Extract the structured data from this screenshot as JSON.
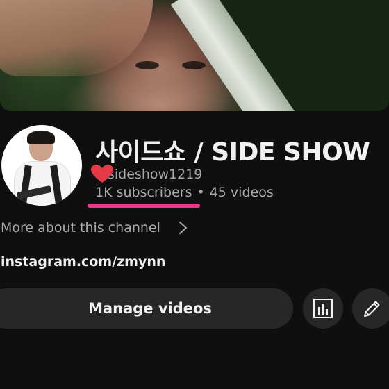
{
  "channel": {
    "title": "사이드쇼 / SIDE SHOW",
    "handle": "sideshow1219",
    "subscribers": "1K subscribers",
    "separator": "•",
    "videos": "45 videos",
    "more_about": "More about this channel",
    "link": "instagram.com/zmynn"
  },
  "actions": {
    "manage_videos": "Manage videos",
    "analytics_icon": "bar-chart-icon",
    "edit_icon": "pencil-icon"
  },
  "annotations": {
    "heart_color": "#e53946",
    "underline_color": "#ff2e8a"
  },
  "colors": {
    "background": "#0f0f0f",
    "button_bg": "#272727",
    "primary_text": "#f1f1f1",
    "secondary_text": "#aaaaaa"
  }
}
